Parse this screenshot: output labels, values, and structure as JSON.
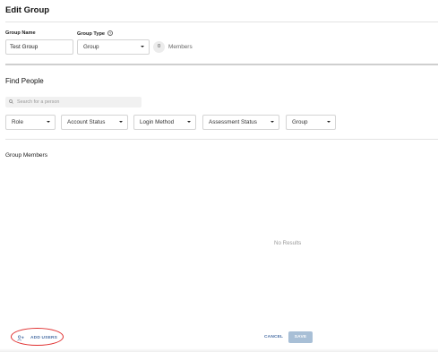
{
  "header": {
    "title": "Edit Group"
  },
  "form": {
    "group_name_label": "Group Name",
    "group_name_value": "Test Group",
    "group_type_label": "Group Type",
    "group_type_value": "Group",
    "member_count": "0",
    "members_label": "Members"
  },
  "find_people": {
    "title": "Find People",
    "search_placeholder": "Search for a person",
    "filters": {
      "role": "Role",
      "account_status": "Account Status",
      "login_method": "Login Method",
      "assessment_status": "Assessment Status",
      "group": "Group"
    }
  },
  "group_members": {
    "title": "Group Members",
    "empty_text": "No Results"
  },
  "footer": {
    "add_users_label": "ADD USERS",
    "cancel_label": "CANCEL",
    "save_label": "SAVE"
  },
  "colors": {
    "accent": "#4a6fa5",
    "save_disabled": "#a8bfd6",
    "highlight_ellipse": "#e03030"
  },
  "icons": {
    "help": "help-circle-icon",
    "search": "search-icon",
    "add_user": "add-user-icon",
    "dropdown": "caret-down-icon"
  }
}
